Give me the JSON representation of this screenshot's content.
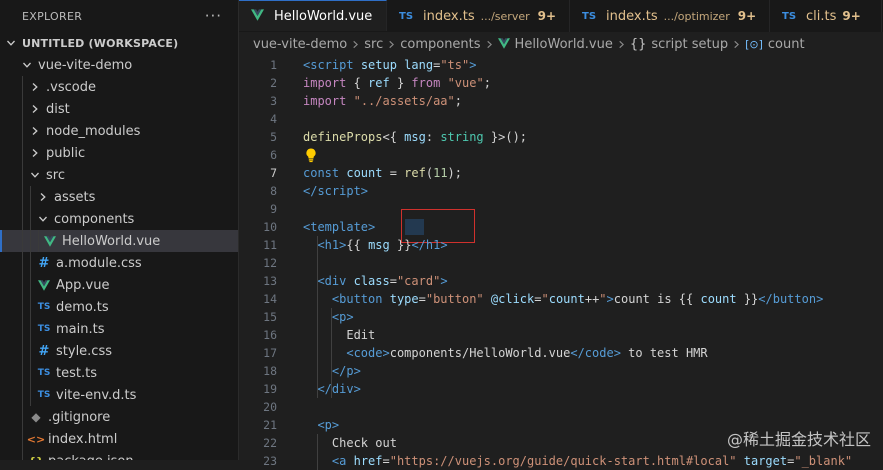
{
  "sidebar": {
    "title": "EXPLORER",
    "more": "···",
    "workspace": "UNTITLED (WORKSPACE)",
    "items": [
      {
        "label": "vue-vite-demo",
        "kind": "folder-open",
        "indent": 1
      },
      {
        "label": ".vscode",
        "kind": "folder",
        "indent": 2
      },
      {
        "label": "dist",
        "kind": "folder",
        "indent": 2
      },
      {
        "label": "node_modules",
        "kind": "folder",
        "indent": 2
      },
      {
        "label": "public",
        "kind": "folder",
        "indent": 2
      },
      {
        "label": "src",
        "kind": "folder-open",
        "indent": 2
      },
      {
        "label": "assets",
        "kind": "folder",
        "indent": 3
      },
      {
        "label": "components",
        "kind": "folder-open",
        "indent": 3
      },
      {
        "label": "HelloWorld.vue",
        "kind": "vue",
        "indent": 4,
        "selected": true
      },
      {
        "label": "a.module.css",
        "kind": "css",
        "indent": 3
      },
      {
        "label": "App.vue",
        "kind": "vue",
        "indent": 3
      },
      {
        "label": "demo.ts",
        "kind": "ts",
        "indent": 3
      },
      {
        "label": "main.ts",
        "kind": "ts",
        "indent": 3
      },
      {
        "label": "style.css",
        "kind": "css",
        "indent": 3
      },
      {
        "label": "test.ts",
        "kind": "ts",
        "indent": 3
      },
      {
        "label": "vite-env.d.ts",
        "kind": "ts",
        "indent": 3
      },
      {
        "label": ".gitignore",
        "kind": "git",
        "indent": 2
      },
      {
        "label": "index.html",
        "kind": "html",
        "indent": 2
      },
      {
        "label": "package.json",
        "kind": "json",
        "indent": 2
      }
    ]
  },
  "tabs": [
    {
      "name": "HelloWorld.vue",
      "kind": "vue",
      "active": true,
      "close": "×"
    },
    {
      "name": "index.ts",
      "kind": "ts",
      "desc": ".../server",
      "badge": "9+"
    },
    {
      "name": "index.ts",
      "kind": "ts",
      "desc": ".../optimizer",
      "badge": "9+"
    },
    {
      "name": "cli.ts",
      "kind": "ts",
      "badge": "9+"
    }
  ],
  "icons": {
    "ts": "TS",
    "css": "#",
    "git": "◆",
    "html": "<>",
    "json": "{}"
  },
  "breadcrumb": {
    "parts": [
      "vue-vite-demo",
      "src",
      "components"
    ],
    "file": "HelloWorld.vue",
    "brace": "{}",
    "scope": "script setup",
    "var_icon": "[⊙]",
    "symbol": "count"
  },
  "editor": {
    "lines": [
      {
        "n": "1",
        "tokens": [
          [
            "t-tag",
            "<script"
          ],
          [
            "t-plain",
            " "
          ],
          [
            "t-var",
            "setup"
          ],
          [
            "t-plain",
            " "
          ],
          [
            "t-var",
            "lang"
          ],
          [
            "t-plain",
            "="
          ],
          [
            "t-str",
            "\"ts\""
          ],
          [
            "t-tag",
            ">"
          ]
        ]
      },
      {
        "n": "2",
        "tokens": [
          [
            "t-kw",
            "import"
          ],
          [
            "t-plain",
            " { "
          ],
          [
            "t-var",
            "ref"
          ],
          [
            "t-plain",
            " } "
          ],
          [
            "t-kw",
            "from"
          ],
          [
            "t-plain",
            " "
          ],
          [
            "t-str",
            "\"vue\""
          ],
          [
            "t-plain",
            ";"
          ]
        ]
      },
      {
        "n": "3",
        "tokens": [
          [
            "t-kw",
            "import"
          ],
          [
            "t-plain",
            " "
          ],
          [
            "t-str",
            "\"../assets/aa\""
          ],
          [
            "t-plain",
            ";"
          ]
        ]
      },
      {
        "n": "4",
        "tokens": []
      },
      {
        "n": "5",
        "tokens": [
          [
            "t-fn",
            "defineProps"
          ],
          [
            "t-plain",
            "<{ "
          ],
          [
            "t-var",
            "msg"
          ],
          [
            "t-plain",
            ": "
          ],
          [
            "t-type",
            "string"
          ],
          [
            "t-plain",
            " }>();"
          ]
        ]
      },
      {
        "n": "6",
        "tokens": [],
        "bulb": true
      },
      {
        "n": "7",
        "tokens": [
          [
            "t-decl",
            "const"
          ],
          [
            "t-plain",
            " "
          ],
          [
            "t-var",
            "count"
          ],
          [
            "t-plain",
            " = "
          ],
          [
            "t-fn",
            "ref"
          ],
          [
            "t-plain",
            "("
          ],
          [
            "t-num",
            "11"
          ],
          [
            "t-plain",
            ");"
          ]
        ],
        "current": true
      },
      {
        "n": "8",
        "tokens": [
          [
            "t-tag",
            "</script"
          ],
          [
            "t-tag",
            ">"
          ]
        ]
      },
      {
        "n": "9",
        "tokens": []
      },
      {
        "n": "10",
        "tokens": [
          [
            "t-tag",
            "<template"
          ],
          [
            "t-tag",
            ">"
          ]
        ]
      },
      {
        "n": "11",
        "tokens": [
          [
            "t-plain",
            "  "
          ],
          [
            "t-tag",
            "<h1"
          ],
          [
            "t-tag",
            ">"
          ],
          [
            "t-plain",
            "{{ "
          ],
          [
            "t-var",
            "msg"
          ],
          [
            "t-plain",
            " }}"
          ],
          [
            "t-tag",
            "</h1"
          ],
          [
            "t-tag",
            ">"
          ]
        ]
      },
      {
        "n": "12",
        "tokens": []
      },
      {
        "n": "13",
        "tokens": [
          [
            "t-plain",
            "  "
          ],
          [
            "t-tag",
            "<div"
          ],
          [
            "t-plain",
            " "
          ],
          [
            "t-var",
            "class"
          ],
          [
            "t-plain",
            "="
          ],
          [
            "t-str",
            "\"card\""
          ],
          [
            "t-tag",
            ">"
          ]
        ]
      },
      {
        "n": "14",
        "tokens": [
          [
            "t-plain",
            "    "
          ],
          [
            "t-tag",
            "<button"
          ],
          [
            "t-plain",
            " "
          ],
          [
            "t-var",
            "type"
          ],
          [
            "t-plain",
            "="
          ],
          [
            "t-str",
            "\"button\""
          ],
          [
            "t-plain",
            " "
          ],
          [
            "t-var",
            "@click"
          ],
          [
            "t-plain",
            "="
          ],
          [
            "t-str",
            "\""
          ],
          [
            "t-var",
            "count"
          ],
          [
            "t-plain",
            "++"
          ],
          [
            "t-str",
            "\""
          ],
          [
            "t-tag",
            ">"
          ],
          [
            "t-plain",
            "count is {{ "
          ],
          [
            "t-var",
            "count"
          ],
          [
            "t-plain",
            " }}"
          ],
          [
            "t-tag",
            "</button"
          ],
          [
            "t-tag",
            ">"
          ]
        ]
      },
      {
        "n": "15",
        "tokens": [
          [
            "t-plain",
            "    "
          ],
          [
            "t-tag",
            "<p"
          ],
          [
            "t-tag",
            ">"
          ]
        ]
      },
      {
        "n": "16",
        "tokens": [
          [
            "t-plain",
            "      Edit"
          ]
        ]
      },
      {
        "n": "17",
        "tokens": [
          [
            "t-plain",
            "      "
          ],
          [
            "t-tag",
            "<code"
          ],
          [
            "t-tag",
            ">"
          ],
          [
            "t-plain",
            "components/HelloWorld.vue"
          ],
          [
            "t-tag",
            "</code"
          ],
          [
            "t-tag",
            ">"
          ],
          [
            "t-plain",
            " to test HMR"
          ]
        ]
      },
      {
        "n": "18",
        "tokens": [
          [
            "t-plain",
            "    "
          ],
          [
            "t-tag",
            "</p"
          ],
          [
            "t-tag",
            ">"
          ]
        ]
      },
      {
        "n": "19",
        "tokens": [
          [
            "t-plain",
            "  "
          ],
          [
            "t-tag",
            "</div"
          ],
          [
            "t-tag",
            ">"
          ]
        ]
      },
      {
        "n": "20",
        "tokens": []
      },
      {
        "n": "21",
        "tokens": [
          [
            "t-plain",
            "  "
          ],
          [
            "t-tag",
            "<p"
          ],
          [
            "t-tag",
            ">"
          ]
        ]
      },
      {
        "n": "22",
        "tokens": [
          [
            "t-plain",
            "    Check out"
          ]
        ]
      },
      {
        "n": "23",
        "tokens": [
          [
            "t-plain",
            "    "
          ],
          [
            "t-tag",
            "<a"
          ],
          [
            "t-plain",
            " "
          ],
          [
            "t-var",
            "href"
          ],
          [
            "t-plain",
            "="
          ],
          [
            "t-str",
            "\"https://vuejs.org/guide/quick-start.html#local\""
          ],
          [
            "t-plain",
            " "
          ],
          [
            "t-var",
            "target"
          ],
          [
            "t-plain",
            "="
          ],
          [
            "t-str",
            "\"_blank\""
          ]
        ]
      }
    ]
  },
  "watermark": "@稀土掘金技术社区",
  "colors": {
    "accent": "#2f6fc7",
    "highlight_box": "#d0312d",
    "vue_green": "#41b883",
    "ts_blue": "#3c8ee0"
  }
}
